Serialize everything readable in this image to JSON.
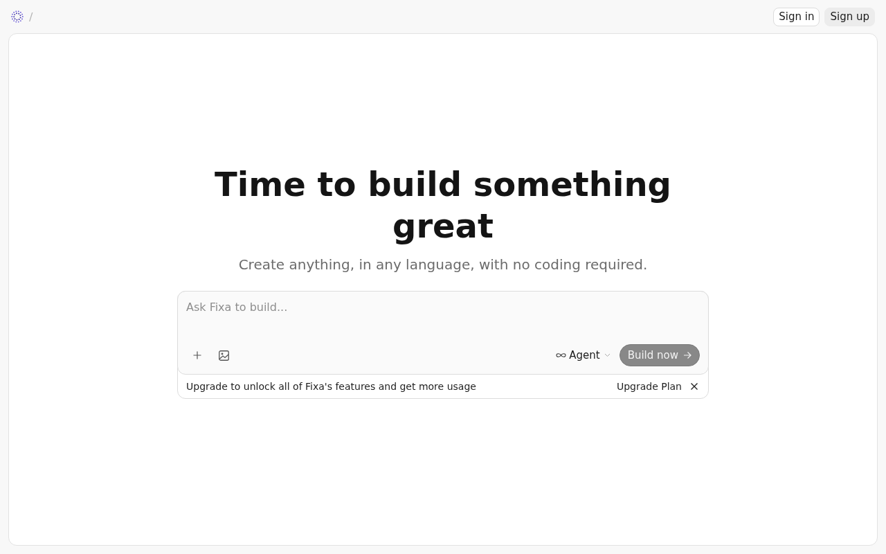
{
  "header": {
    "breadcrumb_separator": "/",
    "buttons": [
      {
        "label": "Sign in",
        "kind": "outline"
      },
      {
        "label": "Sign up",
        "kind": "filled"
      }
    ]
  },
  "hero": {
    "title": "Time to build something great",
    "subtitle": "Create anything, in any language, with no coding required."
  },
  "prompt": {
    "placeholder": "Ask Fixa to build...",
    "mode": {
      "label": "Agent"
    },
    "submit": {
      "label": "Build now",
      "disabled": true
    }
  },
  "upgrade_banner": {
    "text": "Upgrade to unlock all of Fixa's features and get more usage",
    "link": "Upgrade Plan"
  }
}
